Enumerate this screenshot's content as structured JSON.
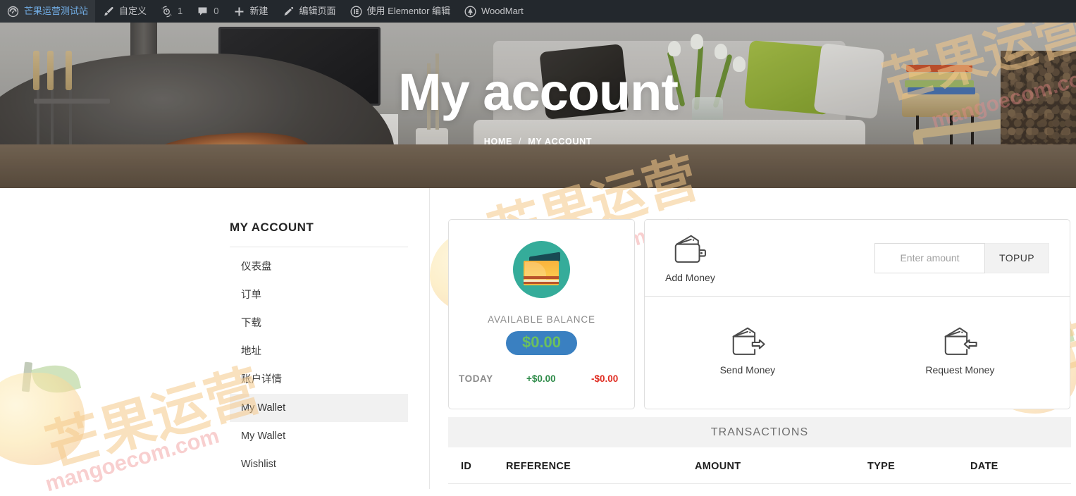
{
  "adminbar": {
    "items": [
      {
        "icon": "wordpress-dashboard-icon",
        "label": "芒果运营测试站",
        "name": "site-name"
      },
      {
        "icon": "brush-icon",
        "label": "自定义",
        "name": "customize"
      },
      {
        "icon": "updates-icon",
        "label": "1",
        "name": "updates"
      },
      {
        "icon": "comment-bubble-icon",
        "label": "0",
        "name": "comments"
      },
      {
        "icon": "plus-icon",
        "label": "新建",
        "name": "new-content"
      },
      {
        "icon": "pencil-icon",
        "label": "编辑页面",
        "name": "edit-page"
      },
      {
        "icon": "elementor-icon",
        "label": "使用 Elementor 编辑",
        "name": "edit-with-elementor"
      },
      {
        "icon": "woodmart-icon",
        "label": "WoodMart",
        "name": "woodmart"
      }
    ]
  },
  "hero": {
    "title": "My account",
    "breadcrumb": {
      "home": "HOME",
      "separator": "/",
      "current": "MY ACCOUNT"
    }
  },
  "sidebar": {
    "title": "MY ACCOUNT",
    "items": [
      {
        "label": "仪表盘",
        "name": "sidebar-item-dashboard",
        "active": false
      },
      {
        "label": "订单",
        "name": "sidebar-item-orders",
        "active": false
      },
      {
        "label": "下载",
        "name": "sidebar-item-downloads",
        "active": false
      },
      {
        "label": "地址",
        "name": "sidebar-item-addresses",
        "active": false
      },
      {
        "label": "账户详情",
        "name": "sidebar-item-account-details",
        "active": false
      },
      {
        "label": "My Wallet",
        "name": "sidebar-item-my-wallet",
        "active": true
      },
      {
        "label": "My Wallet",
        "name": "sidebar-item-my-wallet-2",
        "active": false
      },
      {
        "label": "Wishlist",
        "name": "sidebar-item-wishlist",
        "active": false
      }
    ]
  },
  "wallet": {
    "available_label": "AVAILABLE BALANCE",
    "balance": "$0.00",
    "today_label": "TODAY",
    "today_credit": "+$0.00",
    "today_debit": "-$0.00",
    "balance_badge_bg": "#3a80c1",
    "balance_badge_color": "#6cc05d",
    "credit_color": "#2e8b49",
    "debit_color": "#e02b20",
    "circle_color": "#35ac9a"
  },
  "actions": {
    "add_money": "Add Money",
    "send_money": "Send Money",
    "request_money": "Request Money",
    "amount_placeholder": "Enter amount",
    "amount_value": "",
    "topup_label": "TOPUP"
  },
  "transactions": {
    "title": "TRANSACTIONS",
    "columns": [
      "ID",
      "REFERENCE",
      "AMOUNT",
      "TYPE",
      "DATE"
    ],
    "rows": []
  },
  "watermark": {
    "cn": "芒果运营",
    "domain": "mangoecom.com"
  }
}
